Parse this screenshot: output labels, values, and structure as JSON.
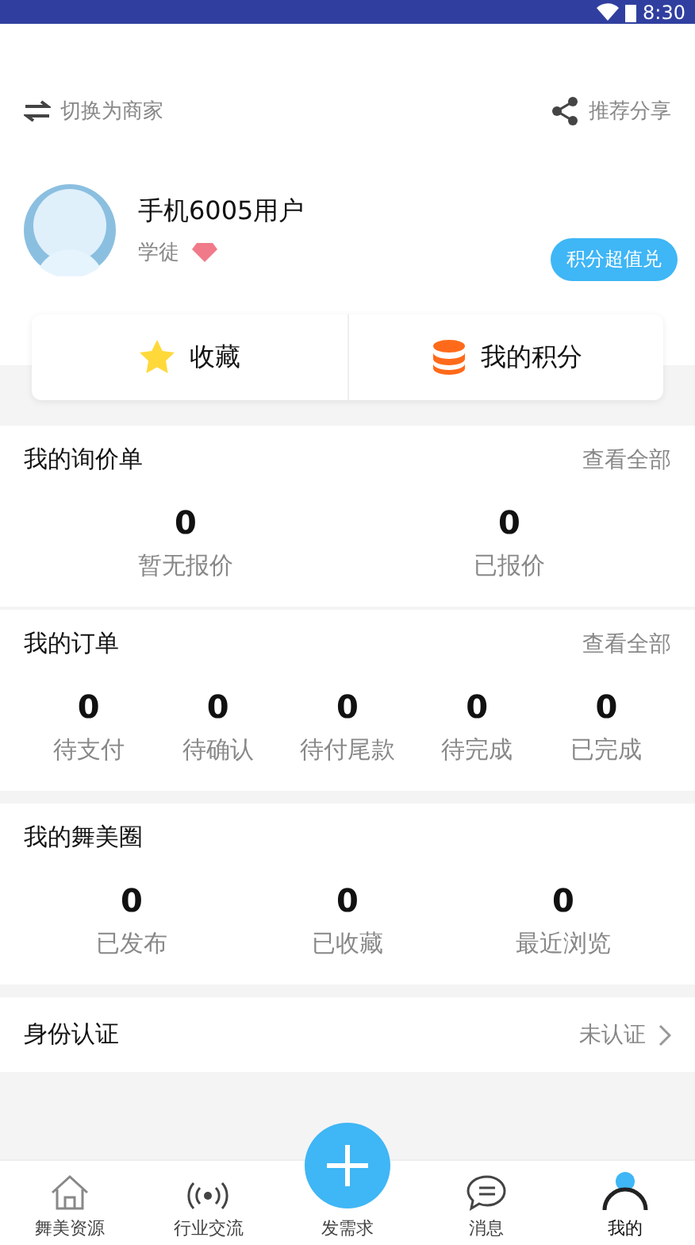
{
  "status_bar": {
    "time": "8:30"
  },
  "top_actions": {
    "switch": "切换为商家",
    "share": "推荐分享"
  },
  "profile": {
    "name": "手机6005用户",
    "level": "学徒",
    "promo": "积分超值兑"
  },
  "quick_links": [
    {
      "kind": "star",
      "label": "收藏"
    },
    {
      "kind": "coins",
      "label": "我的积分"
    }
  ],
  "sections": [
    {
      "title": "我的询价单",
      "more": "查看全部",
      "stats": [
        {
          "value": "0",
          "label": "暂无报价"
        },
        {
          "value": "0",
          "label": "已报价"
        }
      ]
    },
    {
      "title": "我的订单",
      "more": "查看全部",
      "stats": [
        {
          "value": "0",
          "label": "待支付"
        },
        {
          "value": "0",
          "label": "待确认"
        },
        {
          "value": "0",
          "label": "待付尾款"
        },
        {
          "value": "0",
          "label": "待完成"
        },
        {
          "value": "0",
          "label": "已完成"
        }
      ]
    },
    {
      "title": "我的舞美圈",
      "stats": [
        {
          "value": "0",
          "label": "已发布"
        },
        {
          "value": "0",
          "label": "已收藏"
        },
        {
          "value": "0",
          "label": "最近浏览"
        }
      ]
    }
  ],
  "verification": {
    "title": "身份认证",
    "status": "未认证"
  },
  "bottom_nav": [
    {
      "kind": "home",
      "label": "舞美资源",
      "selected": false
    },
    {
      "kind": "signal",
      "label": "行业交流",
      "selected": false
    },
    {
      "kind": "plus",
      "label": "发需求",
      "selected": false
    },
    {
      "kind": "chat",
      "label": "消息",
      "selected": false
    },
    {
      "kind": "person",
      "label": "我的",
      "selected": true
    }
  ]
}
